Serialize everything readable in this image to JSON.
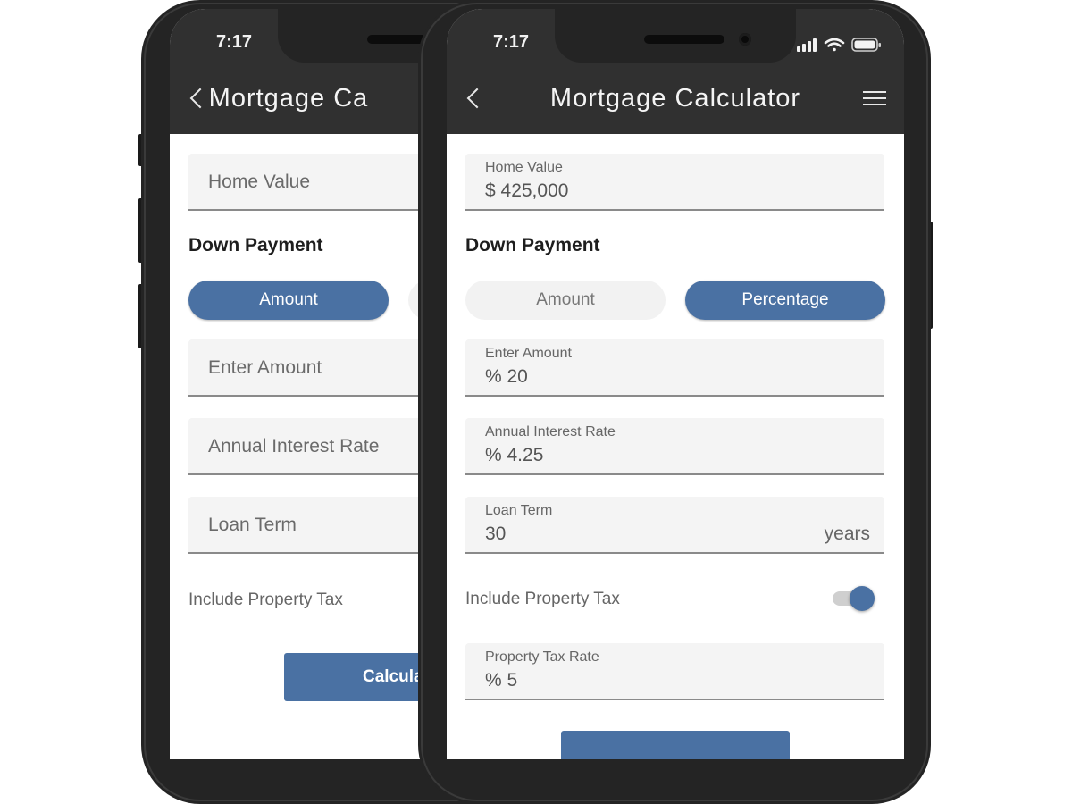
{
  "status": {
    "time": "7:17"
  },
  "header": {
    "title": "Mortgage Calculator"
  },
  "back_phone": {
    "header_title": "Mortgage Ca",
    "home_value_placeholder": "Home Value",
    "section_down_payment": "Down Payment",
    "toggle_amount": "Amount",
    "enter_amount_placeholder": "Enter Amount",
    "interest_placeholder": "Annual Interest Rate",
    "loan_term_placeholder": "Loan Term",
    "property_tax_label": "Include Property Tax",
    "calculate_label": "Calcula"
  },
  "form": {
    "home_value": {
      "label": "Home Value",
      "value": "$ 425,000"
    },
    "section_down_payment": "Down Payment",
    "down_payment_toggle": {
      "amount": "Amount",
      "percentage": "Percentage",
      "selected": "Percentage"
    },
    "enter_amount": {
      "label": "Enter Amount",
      "value": "% 20"
    },
    "interest_rate": {
      "label": "Annual Interest Rate",
      "value": "% 4.25"
    },
    "loan_term": {
      "label": "Loan Term",
      "value": "30",
      "suffix": "years"
    },
    "property_tax": {
      "label": "Include Property Tax",
      "enabled": true
    },
    "property_tax_rate": {
      "label": "Property Tax Rate",
      "value": "% 5"
    }
  },
  "colors": {
    "accent": "#4a71a3",
    "header_bg": "#303030",
    "field_bg": "#f4f4f4",
    "frame": "#242424"
  },
  "icons": {
    "back": "chevron-left-icon",
    "menu": "hamburger-menu-icon",
    "signal": "cellular-signal-icon",
    "wifi": "wifi-icon",
    "battery": "battery-icon"
  }
}
